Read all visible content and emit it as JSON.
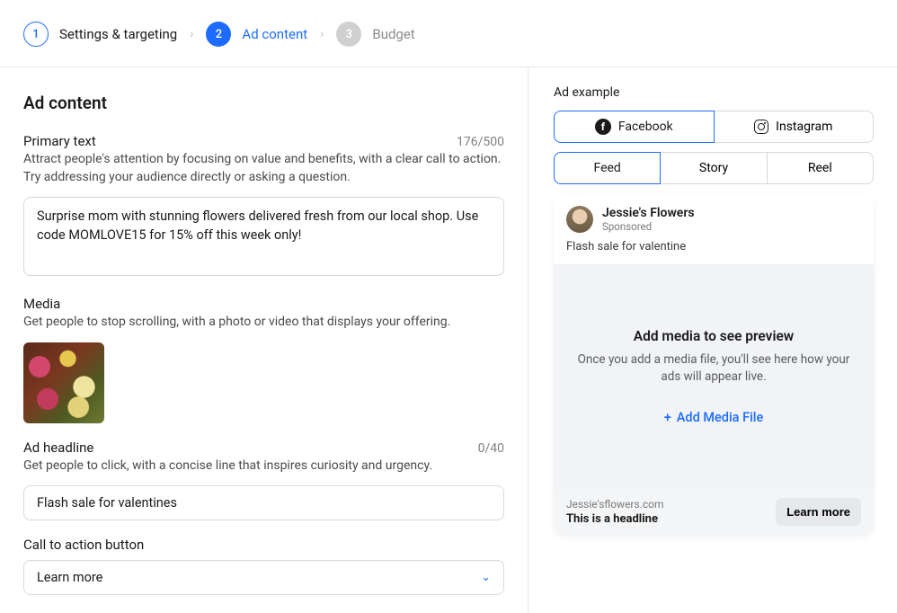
{
  "stepper": {
    "step1": {
      "num": "1",
      "label": "Settings & targeting"
    },
    "step2": {
      "num": "2",
      "label": "Ad content"
    },
    "step3": {
      "num": "3",
      "label": "Budget"
    }
  },
  "section_title": "Ad content",
  "fields": {
    "primary": {
      "label": "Primary text",
      "counter": "176/500",
      "help": "Attract people's attention by focusing on value and benefits, with a clear call to action. Try addressing your audience directly or asking a question.",
      "value": "Surprise mom with stunning flowers delivered fresh from our local shop. Use code MOMLOVE15 for 15% off this week only!"
    },
    "media": {
      "label": "Media",
      "help": "Get people to stop scrolling, with a photo or video that displays your offering."
    },
    "headline": {
      "label": "Ad headline",
      "counter": "0/40",
      "help": "Get people to click, with a concise line that inspires curiosity and urgency.",
      "value": "Flash sale for valentines"
    },
    "cta": {
      "label": "Call to action button",
      "value": "Learn more"
    }
  },
  "preview": {
    "label": "Ad example",
    "platforms": {
      "facebook": "Facebook",
      "instagram": "Instagram"
    },
    "formats": {
      "feed": "Feed",
      "story": "Story",
      "reel": "Reel"
    },
    "post": {
      "page_name": "Jessie's Flowers",
      "sponsored": "Sponsored",
      "body_text": "Flash sale for valentine",
      "placeholder_title": "Add media to see preview",
      "placeholder_body": "Once you add a media file, you'll see here how your ads will appear live.",
      "add_media_label": "Add Media File",
      "footer_domain": "Jessie'sflowers.com",
      "footer_headline": "This is a headline",
      "cta_button": "Learn more"
    }
  }
}
